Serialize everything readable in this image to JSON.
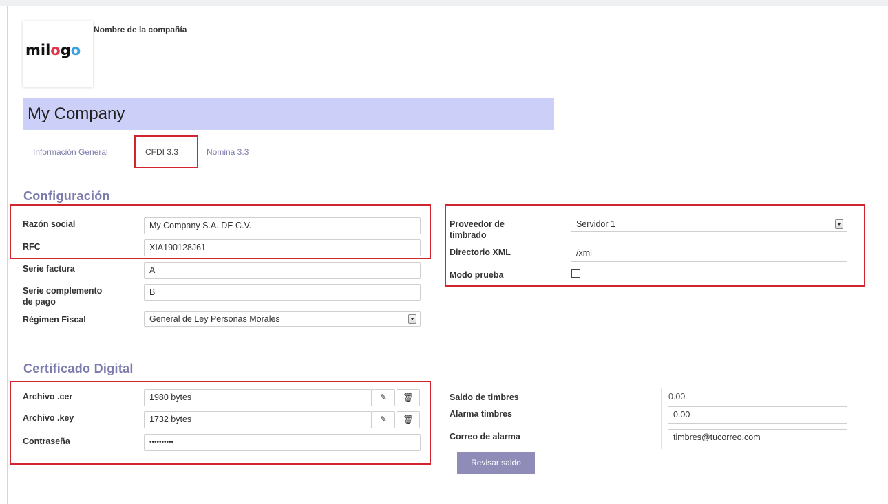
{
  "company": {
    "logo": {
      "parts": [
        "mil",
        "o",
        "g",
        "o"
      ]
    },
    "label": "Nombre de la compañía",
    "name": "My Company"
  },
  "tabs": [
    {
      "label": "Información General"
    },
    {
      "label": "CFDI 3.3"
    },
    {
      "label": "Nomina 3.3"
    }
  ],
  "configuracion": {
    "title": "Configuración",
    "razon_social": {
      "label": "Razón social",
      "value": "My Company S.A. DE C.V."
    },
    "rfc": {
      "label": "RFC",
      "value": "XIA190128J61"
    },
    "serie_factura": {
      "label": "Serie factura",
      "value": "A"
    },
    "serie_complemento": {
      "label_line1": "Serie complemento",
      "label_line2": "de pago",
      "value": "B"
    },
    "regimen_fiscal": {
      "label": "Régimen Fiscal",
      "value": "General de Ley Personas Morales"
    },
    "proveedor": {
      "label_line1": "Proveedor de",
      "label_line2": "timbrado",
      "value": "Servidor 1"
    },
    "directorio_xml": {
      "label": "Directorio XML",
      "value": "/xml"
    },
    "modo_prueba": {
      "label": "Modo prueba",
      "checked": false
    }
  },
  "certificado": {
    "title": "Certificado Digital",
    "archivo_cer": {
      "label": "Archivo .cer",
      "value": "1980 bytes"
    },
    "archivo_key": {
      "label": "Archivo .key",
      "value": "1732 bytes"
    },
    "contrasena": {
      "label": "Contraseña",
      "value": "••••••••••"
    },
    "saldo_timbres": {
      "label": "Saldo de timbres",
      "value": "0.00"
    },
    "alarma_timbres": {
      "label": "Alarma timbres",
      "value": "0.00"
    },
    "correo_alarma": {
      "label": "Correo de alarma",
      "value": "timbres@tucorreo.com"
    },
    "revisar_saldo": "Revisar saldo"
  },
  "icons": {
    "edit": "pencil-icon",
    "delete": "trash-icon",
    "dropdown": "chevron-down-icon"
  },
  "colors": {
    "accent": "#7c7bad",
    "highlight": "#d0252f",
    "name_field": "#cccff7",
    "button": "#8f8cb8"
  }
}
